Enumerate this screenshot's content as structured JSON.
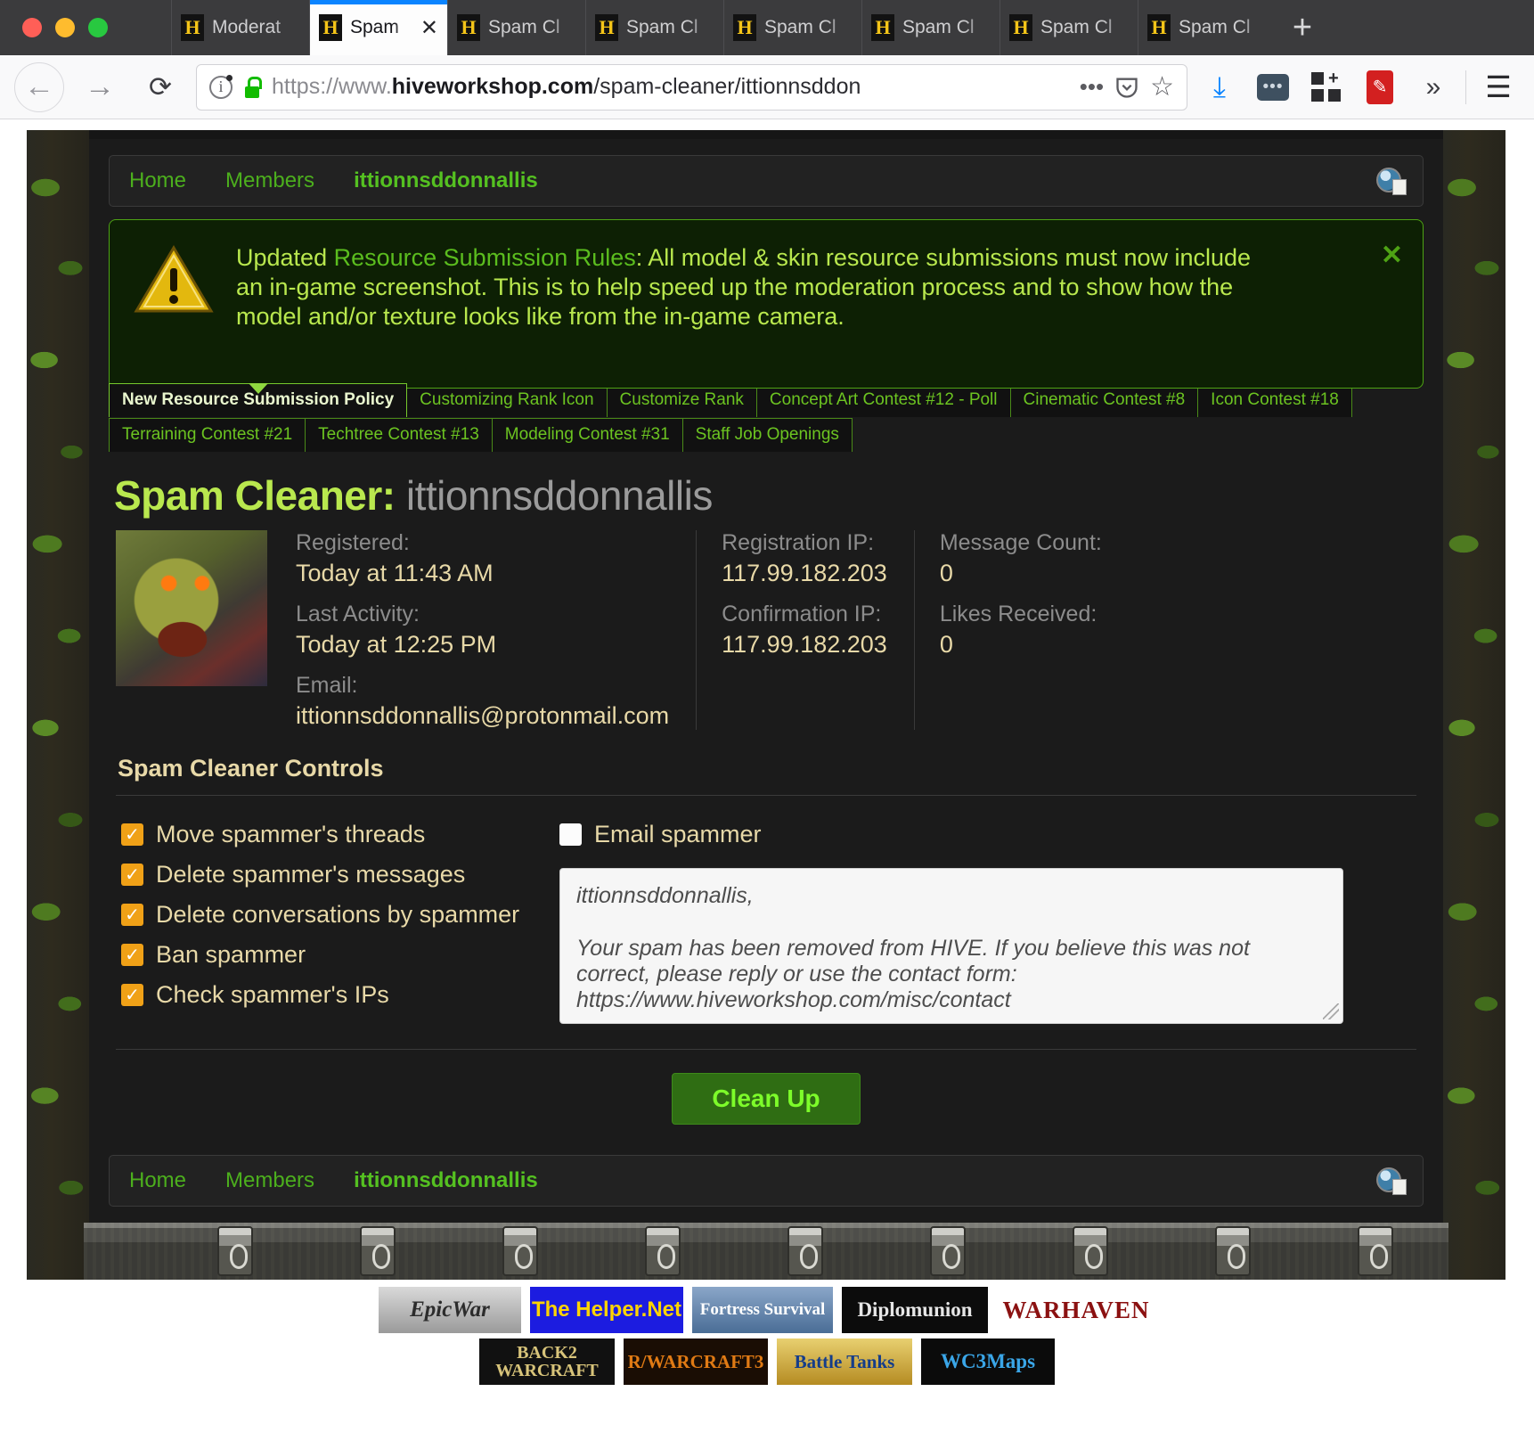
{
  "browser": {
    "tabs": [
      {
        "title": "Moderat",
        "active": false
      },
      {
        "title": "Spam",
        "active": true
      },
      {
        "title": "Spam Cl",
        "active": false
      },
      {
        "title": "Spam Cl",
        "active": false
      },
      {
        "title": "Spam Cl",
        "active": false
      },
      {
        "title": "Spam Cl",
        "active": false
      },
      {
        "title": "Spam Cl",
        "active": false
      },
      {
        "title": "Spam Cl",
        "active": false
      }
    ],
    "favicon_glyph": "H",
    "new_tab_label": "+",
    "close_label": "✕",
    "url_prefix": "https://www.",
    "url_domain": "hiveworkshop.com",
    "url_path": "/spam-cleaner/ittionnsddon",
    "url_full": "https://www.hiveworkshop.com/spam-cleaner/ittionnsddon",
    "back_label": "←",
    "forward_label": "→",
    "reload_label": "⟳",
    "page_actions_label": "•••",
    "pocket_label": "pocket-save",
    "bookmark_label": "☆",
    "download_label": "download",
    "menu_label": "☰",
    "overflow_label": "»"
  },
  "breadcrumb": {
    "items": [
      {
        "label": "Home",
        "current": false
      },
      {
        "label": "Members",
        "current": false
      },
      {
        "label": "ittionnsddonnallis",
        "current": true
      }
    ]
  },
  "notice": {
    "lead": "Updated ",
    "link": "Resource Submission Rules",
    "body": ": All model & skin resource submissions must now include an in-game screenshot. This is to help speed up the moderation process and to show how the model and/or texture looks like from the in-game camera.",
    "close_label": "✕"
  },
  "tabnav": {
    "row1": [
      {
        "label": "New Resource Submission Policy",
        "selected": true
      },
      {
        "label": "Customizing Rank Icon",
        "selected": false
      },
      {
        "label": "Customize Rank",
        "selected": false
      },
      {
        "label": "Concept Art Contest #12 - Poll",
        "selected": false
      },
      {
        "label": "Cinematic Contest #8",
        "selected": false
      },
      {
        "label": "Icon Contest #18",
        "selected": false
      }
    ],
    "row2": [
      {
        "label": "Terraining Contest #21",
        "selected": false
      },
      {
        "label": "Techtree Contest #13",
        "selected": false
      },
      {
        "label": "Modeling Contest #31",
        "selected": false
      },
      {
        "label": "Staff Job Openings",
        "selected": false
      }
    ]
  },
  "heading": {
    "prefix": "Spam Cleaner:",
    "username": "ittionnsddonnallis"
  },
  "profile": {
    "registered_label": "Registered:",
    "registered_value": "Today at 11:43 AM",
    "last_activity_label": "Last Activity:",
    "last_activity_value": "Today at 12:25 PM",
    "email_label": "Email:",
    "email_value": "ittionnsddonnallis@protonmail.com",
    "registration_ip_label": "Registration IP:",
    "registration_ip_value": "117.99.182.203",
    "confirmation_ip_label": "Confirmation IP:",
    "confirmation_ip_value": "117.99.182.203",
    "message_count_label": "Message Count:",
    "message_count_value": "0",
    "likes_received_label": "Likes Received:",
    "likes_received_value": "0"
  },
  "controls": {
    "section_title": "Spam Cleaner Controls",
    "checkboxes": [
      {
        "label": "Move spammer's threads",
        "checked": true
      },
      {
        "label": "Delete spammer's messages",
        "checked": true
      },
      {
        "label": "Delete conversations by spammer",
        "checked": true
      },
      {
        "label": "Ban spammer",
        "checked": true
      },
      {
        "label": "Check spammer's IPs",
        "checked": true
      }
    ],
    "email_spammer": {
      "label": "Email spammer",
      "checked": false
    },
    "message_value": "ittionnsddonnallis,\n\nYour spam has been removed from HIVE. If you believe this was not correct, please reply or use the contact form:\nhttps://www.hiveworkshop.com/misc/contact",
    "submit_label": "Clean Up"
  },
  "footer_banners": {
    "row1": [
      {
        "name": "epicwar",
        "label": "EpicWar"
      },
      {
        "name": "the-helper-net",
        "label": "The Helper.Net"
      },
      {
        "name": "fortress-survival",
        "label": "Fortress\nSurvival"
      },
      {
        "name": "diplomunion",
        "label": "Diplomunion"
      },
      {
        "name": "warhaven",
        "label": "WARHAVEN"
      }
    ],
    "row2": [
      {
        "name": "back2warcraft",
        "label": "BACK2\nWARCRAFT"
      },
      {
        "name": "r-warcraft3",
        "label": "R/WARCRAFT3"
      },
      {
        "name": "battle-tanks",
        "label": "Battle\nTanks"
      },
      {
        "name": "wc3maps",
        "label": "WC3Maps"
      }
    ]
  },
  "colors": {
    "accent_green": "#6cc421",
    "notice_text": "#b9e84e",
    "value_tan": "#e8d9a8",
    "checkbox_orange": "#f0a117",
    "button_green": "#2f6d13"
  }
}
